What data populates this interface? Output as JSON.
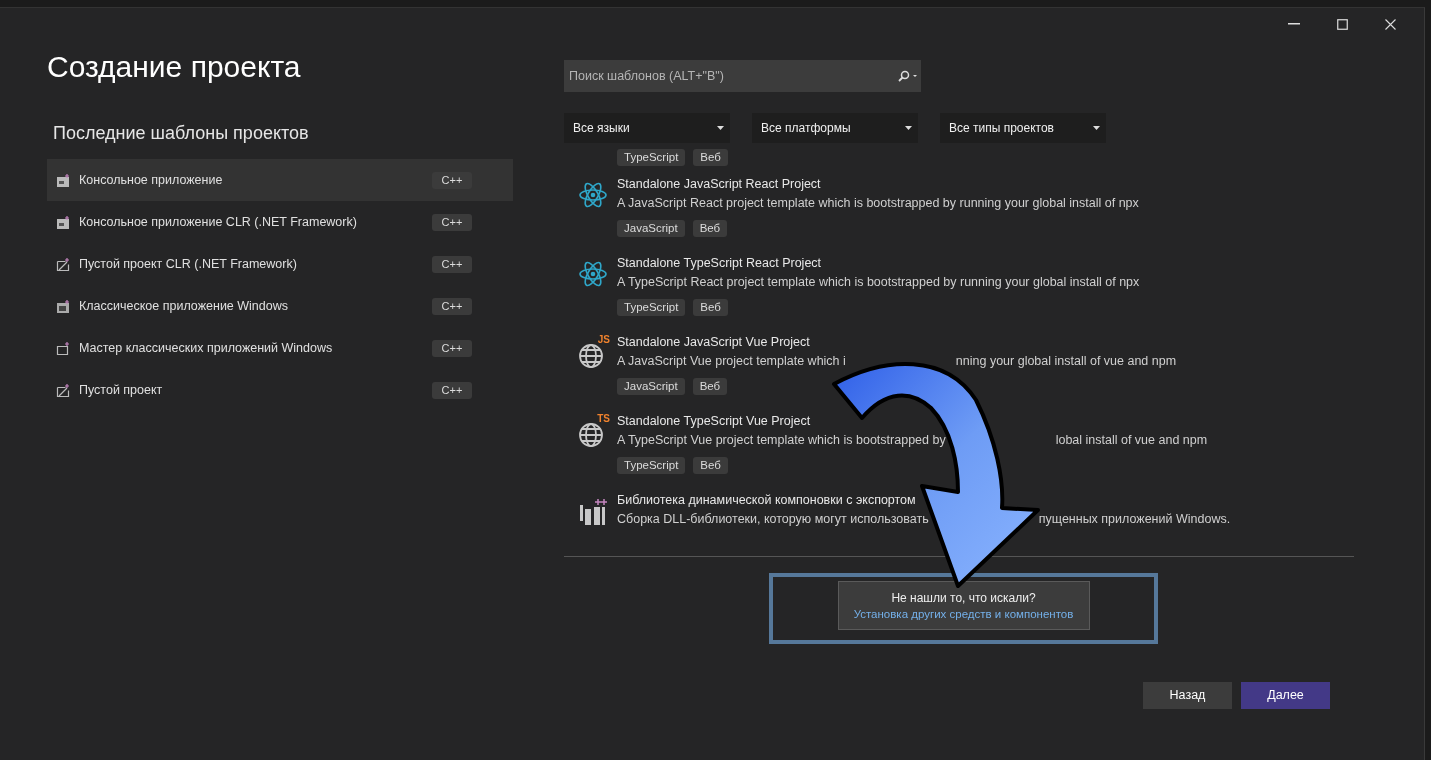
{
  "window": {
    "title": "Создание проекта"
  },
  "recent": {
    "heading": "Последние шаблоны проектов",
    "items": [
      {
        "name": "Консольное приложение",
        "tag": "C++",
        "selected": true,
        "kind": "console"
      },
      {
        "name": "Консольное приложение CLR (.NET Framework)",
        "tag": "C++",
        "selected": false,
        "kind": "console"
      },
      {
        "name": "Пустой проект CLR (.NET Framework)",
        "tag": "C++",
        "selected": false,
        "kind": "empty"
      },
      {
        "name": "Классическое приложение Windows",
        "tag": "C++",
        "selected": false,
        "kind": "desktop"
      },
      {
        "name": "Мастер классических приложений Windows",
        "tag": "C++",
        "selected": false,
        "kind": "wizard"
      },
      {
        "name": "Пустой проект",
        "tag": "C++",
        "selected": false,
        "kind": "empty"
      }
    ]
  },
  "search": {
    "placeholder": "Поиск шаблонов (ALT+\"В\")"
  },
  "filters": [
    "Все языки",
    "Все платформы",
    "Все типы проектов"
  ],
  "templates": [
    {
      "kind": "tags-only",
      "tags": [
        "TypeScript",
        "Веб"
      ]
    },
    {
      "kind": "react",
      "title": [
        "Standalone JavaScript React Project"
      ],
      "description": [
        "A JavaScript React project template which is bootstrapped by running your global install of npx"
      ],
      "tags": [
        "JavaScript",
        "Веб"
      ]
    },
    {
      "kind": "react",
      "title": [
        "Standalone TypeScript React Project"
      ],
      "description": [
        "A TypeScript React project template which is bootstrapped by running your global install of npx"
      ],
      "tags": [
        "TypeScript",
        "Веб"
      ]
    },
    {
      "kind": "globe",
      "badge": "JS",
      "title": [
        "Standalone JavaScript Vue Project"
      ],
      "description": [
        "A JavaScript Vue project template which i",
        "nning your global install of vue and npm"
      ],
      "tags": [
        "JavaScript",
        "Веб"
      ]
    },
    {
      "kind": "globe",
      "badge": "TS",
      "title": [
        "Standalone TypeScript Vue Project"
      ],
      "description": [
        "A TypeScript Vue project template which is bootstrapped by",
        "lobal install of vue and npm"
      ],
      "tags": [
        "TypeScript",
        "Веб"
      ]
    },
    {
      "kind": "dll",
      "title": [
        "Библиотека динамической компоновки с экспортом"
      ],
      "description": [
        "Сборка DLL-библиотеки, которую могут использовать",
        "пущенных приложений Windows."
      ]
    }
  ],
  "not_found": {
    "question": "Не нашли то, что искали?",
    "link": "Установка других средств и компонентов"
  },
  "buttons": [
    {
      "label": "Назад",
      "kind": "secondary"
    },
    {
      "label": "Далее",
      "kind": "primary"
    }
  ]
}
